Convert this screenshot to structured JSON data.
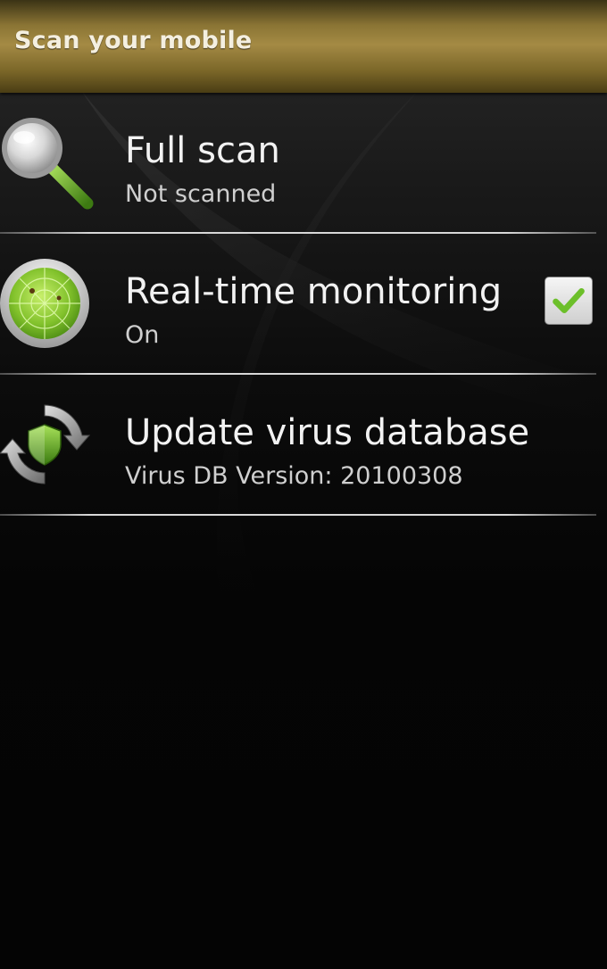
{
  "header": {
    "title": "Scan your mobile"
  },
  "items": [
    {
      "title": "Full scan",
      "subtitle": "Not scanned",
      "icon": "magnifier-icon"
    },
    {
      "title": "Real-time monitoring",
      "subtitle": "On",
      "icon": "radar-icon",
      "checked": true
    },
    {
      "title": "Update virus database",
      "subtitle": "Virus DB Version: 20100308",
      "icon": "shield-refresh-icon"
    }
  ],
  "colors": {
    "title_bar": "#a48a44",
    "accent_green": "#7fc23a",
    "text": "#f2f2f2",
    "subtext": "#cfcfcf"
  }
}
